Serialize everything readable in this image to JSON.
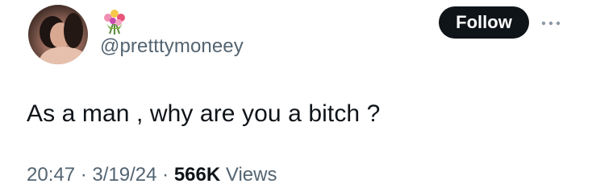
{
  "author": {
    "handle": "@pretttymoneey",
    "display_name_icon": "bouquet-emoji"
  },
  "follow_button": {
    "label": "Follow"
  },
  "more_button": {
    "icon": "more-dots-icon"
  },
  "tweet": {
    "text": "As a man , why are you a bitch ?",
    "time": "20:47",
    "date": "3/19/24",
    "view_count": "566K",
    "views_label": "Views",
    "separator": "·"
  },
  "colors": {
    "text_primary": "#0f1419",
    "text_secondary": "#536471",
    "follow_bg": "#0f1419",
    "follow_text": "#ffffff"
  }
}
